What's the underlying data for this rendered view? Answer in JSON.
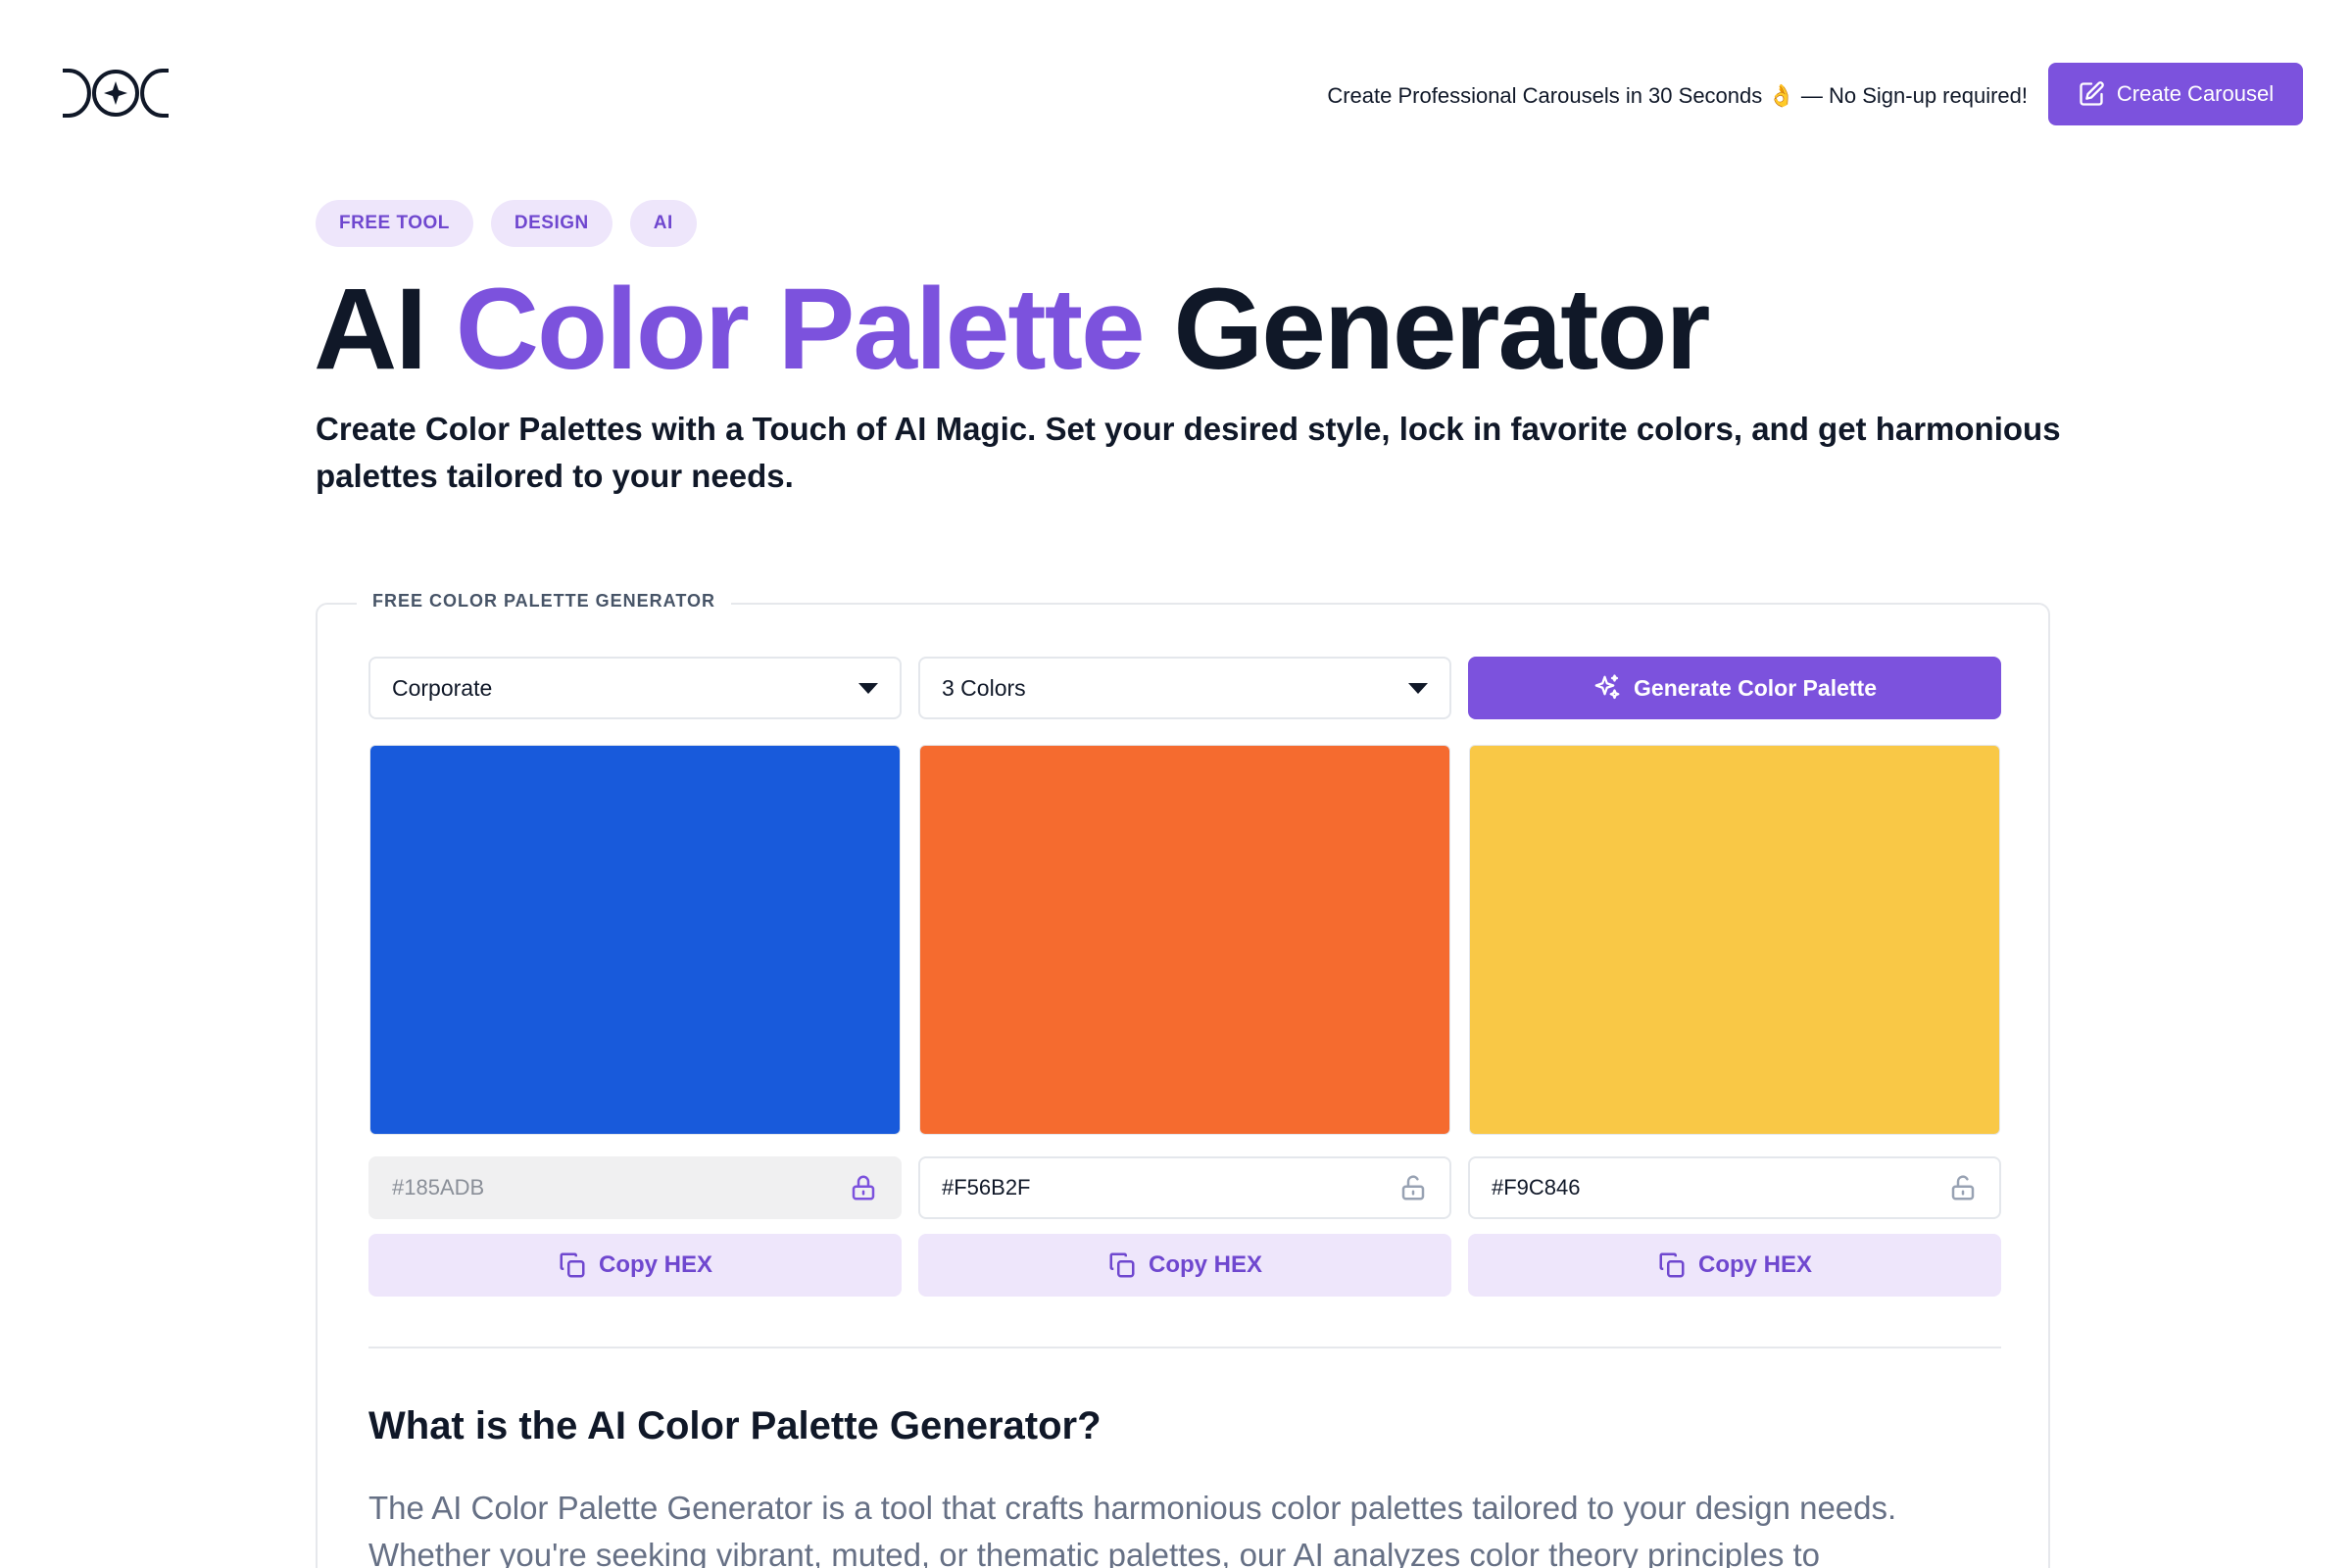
{
  "header": {
    "promo_text": "Create Professional Carousels in 30 Seconds 👌 — No Sign-up required!",
    "cta_label": "Create Carousel"
  },
  "tags": [
    "FREE TOOL",
    "DESIGN",
    "AI"
  ],
  "hero": {
    "title_pre": "AI",
    "title_accent": "Color Palette",
    "title_post": "Generator",
    "subtitle": "Create Color Palettes with a Touch of AI Magic. Set your desired style, lock in favorite colors, and get harmonious palettes tailored to your needs."
  },
  "generator": {
    "legend": "FREE COLOR PALETTE GENERATOR",
    "style_select": "Corporate",
    "count_select": "3 Colors",
    "generate_label": "Generate Color Palette",
    "copy_label": "Copy HEX",
    "colors": [
      {
        "hex": "#185ADB",
        "locked": true
      },
      {
        "hex": "#F56B2F",
        "locked": false
      },
      {
        "hex": "#F9C846",
        "locked": false
      }
    ]
  },
  "about": {
    "heading": "What is the AI Color Palette Generator?",
    "paragraph": "The AI Color Palette Generator is a tool that crafts harmonious color palettes tailored to your design needs. Whether you're seeking vibrant, muted, or thematic palettes, our AI analyzes color theory principles to"
  },
  "theme": {
    "accent": "#7c52dd",
    "accent_soft": "#eee6fb"
  }
}
